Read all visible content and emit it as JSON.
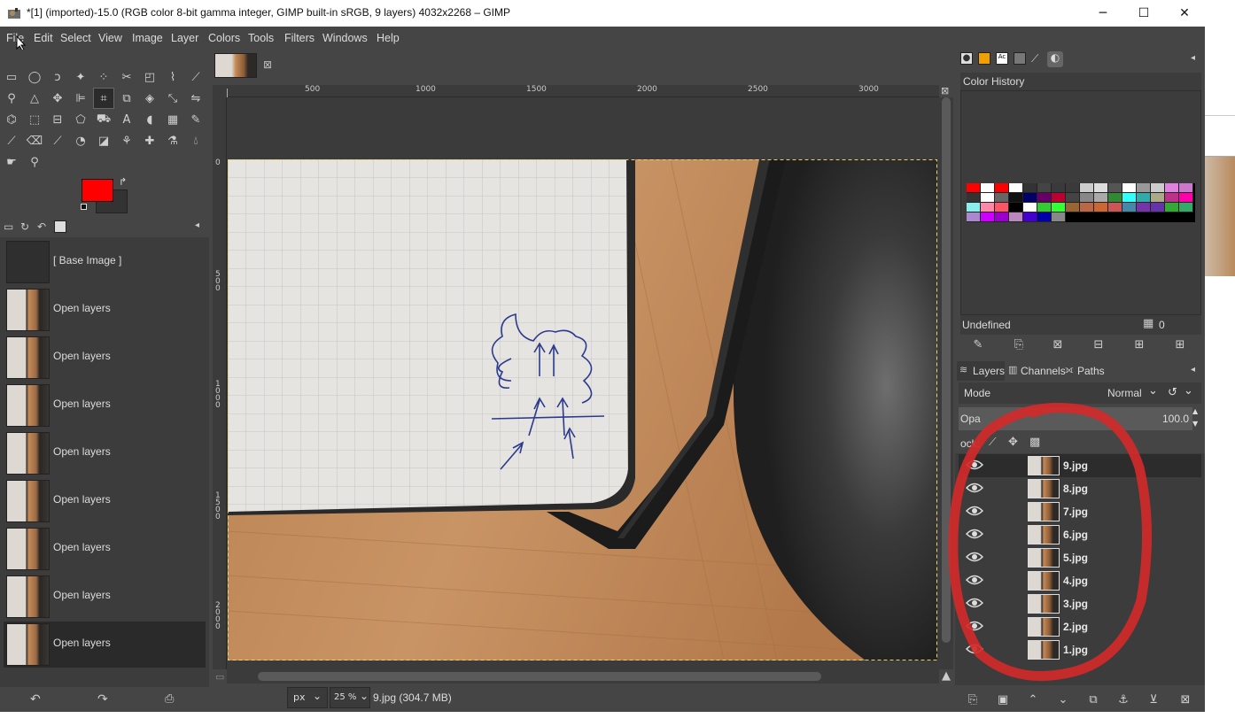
{
  "window": {
    "title": "*[1] (imported)-15.0 (RGB color 8-bit gamma integer, GIMP built-in sRGB, 9 layers) 4032x2268 – GIMP",
    "minimize": "─",
    "maximize": "☐",
    "close": "✕"
  },
  "menubar": [
    "File",
    "Edit",
    "Select",
    "View",
    "Image",
    "Layer",
    "Colors",
    "Tools",
    "Filters",
    "Windows",
    "Help"
  ],
  "colors": {
    "foreground": "#ff0000",
    "background": "#333333",
    "accent_annotation": "#d12a2a"
  },
  "undo_history": {
    "items": [
      {
        "label": "[ Base Image ]",
        "thumb": "base"
      },
      {
        "label": "Open layers"
      },
      {
        "label": "Open layers"
      },
      {
        "label": "Open layers"
      },
      {
        "label": "Open layers"
      },
      {
        "label": "Open layers"
      },
      {
        "label": "Open layers"
      },
      {
        "label": "Open layers"
      },
      {
        "label": "Open layers"
      }
    ]
  },
  "ruler": {
    "h_ticks": [
      "500",
      "1000",
      "1500",
      "2000",
      "2500",
      "3000"
    ],
    "v_ticks": [
      "0",
      "500",
      "1000",
      "1500",
      "2000"
    ]
  },
  "status": {
    "unit": "px",
    "zoom": "25 %",
    "info": "9.jpg (304.7 MB)"
  },
  "right_dock": {
    "color_history_title": "Color History",
    "undefined_label": "Undefined",
    "grid_value": "0",
    "tabs": [
      "Layers",
      "Channels",
      "Paths"
    ],
    "mode_label": "Mode",
    "mode_value": "Normal",
    "opacity_label": "Opa",
    "opacity_value": "100.0",
    "lock_label": "ock:",
    "layers": [
      "9.jpg",
      "8.jpg",
      "7.jpg",
      "6.jpg",
      "5.jpg",
      "4.jpg",
      "3.jpg",
      "2.jpg",
      "1.jpg"
    ]
  },
  "palette": [
    "#ff0000",
    "#ffffff",
    "#ff0000",
    "#ffffff",
    "#333333",
    "#444444",
    "#3a3a3a",
    "#3a3a3a",
    "#cccccc",
    "#dddddd",
    "#555555",
    "#ffffff",
    "#999999",
    "#cccccc",
    "#e080e0",
    "#cc77cc",
    "#333333",
    "#ffffff",
    "#666666",
    "#111111",
    "#000066",
    "#660066",
    "#bb0033",
    "#444444",
    "#888888",
    "#aaaaaa",
    "#338833",
    "#33ffff",
    "#33aaaa",
    "#aaaa88",
    "#bb3388",
    "#ff00aa",
    "#88eeee",
    "#ff88aa",
    "#ff5566",
    "#000000",
    "#ffffff",
    "#33cc33",
    "#33ff33",
    "#996633",
    "#bb6644",
    "#cc6633",
    "#cc5555",
    "#4488aa",
    "#7733aa",
    "#6633aa",
    "#33aa33",
    "#33aa66",
    "#aa88cc",
    "#cc00ff",
    "#9900cc",
    "#bb88bb",
    "#4400cc",
    "#0000aa",
    "#888888"
  ]
}
